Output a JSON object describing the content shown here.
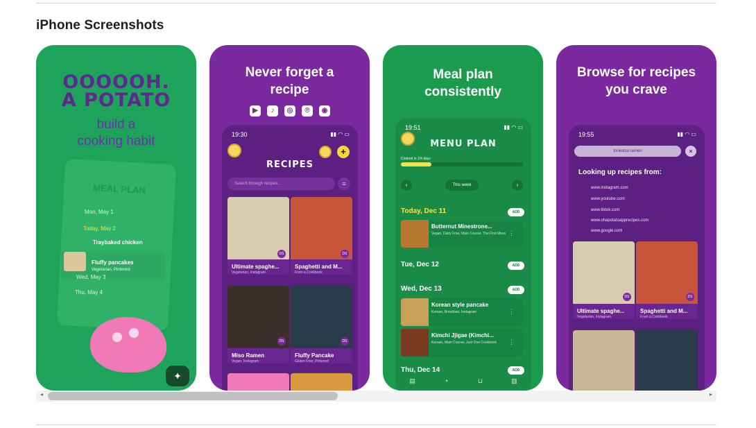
{
  "section_title": "iPhone Screenshots",
  "colors": {
    "green": "#1ea45a",
    "purple": "#7a2a9e",
    "yellow": "#f1e34b",
    "text": "#1d1d1f"
  },
  "shot1": {
    "hero_line1": "OOOOOH.",
    "hero_line2": "A POTATO",
    "sub_line1": "build a",
    "sub_line2": "cooking habit",
    "card_title": "MEAL PLAN",
    "rows": [
      "Mon, May 1",
      "Today, May 2",
      "Wed, May 3",
      "Thu, May 4"
    ],
    "item1": "Traybaked chicken",
    "item2": "Fluffy pancakes",
    "item2_meta": "Vegetarian, Pinterest",
    "magic_icon": "magic-wand-icon"
  },
  "shot2": {
    "heading_line1": "Never forget a",
    "heading_line2": "recipe",
    "socials": [
      "youtube-icon",
      "tiktok-icon",
      "instagram-icon",
      "pinterest-icon",
      "camera-icon"
    ],
    "status_time": "19:30",
    "app_title": "RECIPES",
    "search_placeholder": "Search through recipes...",
    "cards": [
      {
        "title": "Ultimate spaghe...",
        "meta": "Vegetarian, Instagram",
        "color": "#d9cbb0"
      },
      {
        "title": "Spaghetti and M...",
        "meta": "From a Cookbook",
        "color": "#c8553a"
      },
      {
        "title": "Miso Ramen",
        "meta": "Vegan, Instagram",
        "color": "#3b2f2a"
      },
      {
        "title": "Fluffy Pancake",
        "meta": "Gluten Free, Pinterest",
        "color": "#2a3b4a"
      }
    ],
    "badge": "DS"
  },
  "shot3": {
    "heading_line1": "Meal plan",
    "heading_line2": "consistently",
    "status_time": "19:51",
    "app_title": "MENU PLAN",
    "progress_label": "Cooked in 1/4 days",
    "progress": 0.25,
    "week_label": "This week",
    "days": [
      "Today, Dec 11",
      "Tue, Dec 12",
      "Wed, Dec 13",
      "Thu, Dec 14"
    ],
    "add_label": "ADD",
    "meals": [
      {
        "title": "Butternut Minestrone...",
        "meta": "Vegan, Dairy Free, Main Course, The First Mess",
        "color": "#b9782f"
      },
      {
        "title": "Korean style pancake",
        "meta": "Korean, Breakfast, Instagram",
        "color": "#c8a25b"
      },
      {
        "title": "Kimchi Jjigae (Kimchi...",
        "meta": "Korean, Main Course, Just One Cookbook",
        "color": "#7b3a1f"
      }
    ],
    "tabs": [
      "Recipes",
      "Meal plan",
      "Shopping list",
      "Explore"
    ]
  },
  "shot4": {
    "heading_line1": "Browse for recipes",
    "heading_line2": "you crave",
    "status_time": "19:55",
    "search_value": "tonkotsu ramen",
    "looking_label": "Looking up recipes from:",
    "sources": [
      "www.instagram.com",
      "www.youtube.com",
      "www.tiktok.com",
      "www.ohapotatoapprecipes.com",
      "www.google.com"
    ],
    "cards": [
      {
        "title": "Ultimate spaghe...",
        "meta": "Vegetarian, Instagram",
        "color": "#d9cbb0"
      },
      {
        "title": "Spaghetti and M...",
        "meta": "From a Cookbook",
        "color": "#c8553a"
      }
    ]
  },
  "scroll": {
    "left_arrow": "◂",
    "right_arrow": "▸",
    "position": 0.43
  }
}
